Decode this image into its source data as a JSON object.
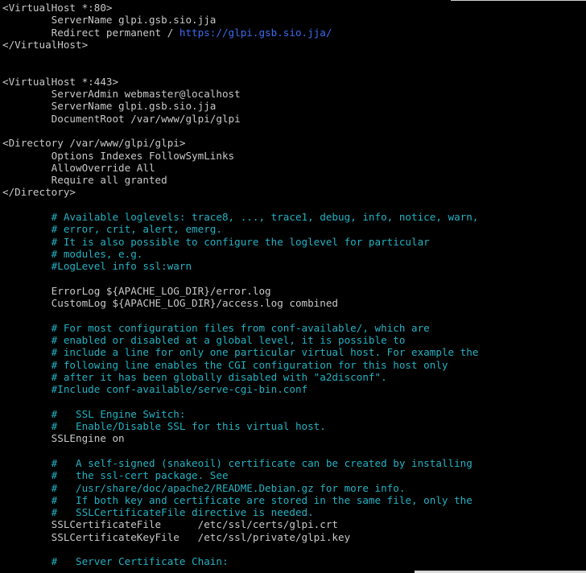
{
  "terminal": {
    "lines": [
      {
        "t": "<VirtualHost *:80>",
        "k": "code"
      },
      {
        "t": "        ServerName glpi.gsb.sio.jja",
        "k": "code"
      },
      {
        "t": "        Redirect permanent / ",
        "k": "code",
        "link": "https://glpi.gsb.sio.jja/"
      },
      {
        "t": "</VirtualHost>",
        "k": "code"
      },
      {
        "t": "",
        "k": "code"
      },
      {
        "t": "",
        "k": "code"
      },
      {
        "t": "<VirtualHost *:443>",
        "k": "code"
      },
      {
        "t": "        ServerAdmin webmaster@localhost",
        "k": "code"
      },
      {
        "t": "        ServerName glpi.gsb.sio.jja",
        "k": "code"
      },
      {
        "t": "        DocumentRoot /var/www/glpi/glpi",
        "k": "code"
      },
      {
        "t": "",
        "k": "code"
      },
      {
        "t": "<Directory /var/www/glpi/glpi>",
        "k": "code"
      },
      {
        "t": "        Options Indexes FollowSymLinks",
        "k": "code"
      },
      {
        "t": "        AllowOverride All",
        "k": "code"
      },
      {
        "t": "        Require all granted",
        "k": "code"
      },
      {
        "t": "</Directory>",
        "k": "code"
      },
      {
        "t": "",
        "k": "code"
      },
      {
        "t": "        # Available loglevels: trace8, ..., trace1, debug, info, notice, warn,",
        "k": "comment"
      },
      {
        "t": "        # error, crit, alert, emerg.",
        "k": "comment"
      },
      {
        "t": "        # It is also possible to configure the loglevel for particular",
        "k": "comment"
      },
      {
        "t": "        # modules, e.g.",
        "k": "comment"
      },
      {
        "t": "        #LogLevel info ssl:warn",
        "k": "comment"
      },
      {
        "t": "",
        "k": "code"
      },
      {
        "t": "        ErrorLog ${APACHE_LOG_DIR}/error.log",
        "k": "code"
      },
      {
        "t": "        CustomLog ${APACHE_LOG_DIR}/access.log combined",
        "k": "code"
      },
      {
        "t": "",
        "k": "code"
      },
      {
        "t": "        # For most configuration files from conf-available/, which are",
        "k": "comment"
      },
      {
        "t": "        # enabled or disabled at a global level, it is possible to",
        "k": "comment"
      },
      {
        "t": "        # include a line for only one particular virtual host. For example the",
        "k": "comment"
      },
      {
        "t": "        # following line enables the CGI configuration for this host only",
        "k": "comment"
      },
      {
        "t": "        # after it has been globally disabled with \"a2disconf\".",
        "k": "comment"
      },
      {
        "t": "        #Include conf-available/serve-cgi-bin.conf",
        "k": "comment"
      },
      {
        "t": "",
        "k": "code"
      },
      {
        "t": "        #   SSL Engine Switch:",
        "k": "comment"
      },
      {
        "t": "        #   Enable/Disable SSL for this virtual host.",
        "k": "comment"
      },
      {
        "t": "        SSLEngine on",
        "k": "code"
      },
      {
        "t": "",
        "k": "code"
      },
      {
        "t": "        #   A self-signed (snakeoil) certificate can be created by installing",
        "k": "comment"
      },
      {
        "t": "        #   the ssl-cert package. See",
        "k": "comment"
      },
      {
        "t": "        #   /usr/share/doc/apache2/README.Debian.gz for more info.",
        "k": "comment"
      },
      {
        "t": "        #   If both key and certificate are stored in the same file, only the",
        "k": "comment"
      },
      {
        "t": "        #   SSLCertificateFile directive is needed.",
        "k": "comment"
      },
      {
        "t": "        SSLCertificateFile      /etc/ssl/certs/glpi.crt",
        "k": "code"
      },
      {
        "t": "        SSLCertificateKeyFile   /etc/ssl/private/glpi.key",
        "k": "code"
      },
      {
        "t": "",
        "k": "code"
      },
      {
        "t": "        #   Server Certificate Chain:",
        "k": "comment"
      }
    ]
  },
  "colors": {
    "background": "#000000",
    "text": "#c8c8c8",
    "comment": "#23b2c2",
    "link": "#3a6cf0"
  }
}
